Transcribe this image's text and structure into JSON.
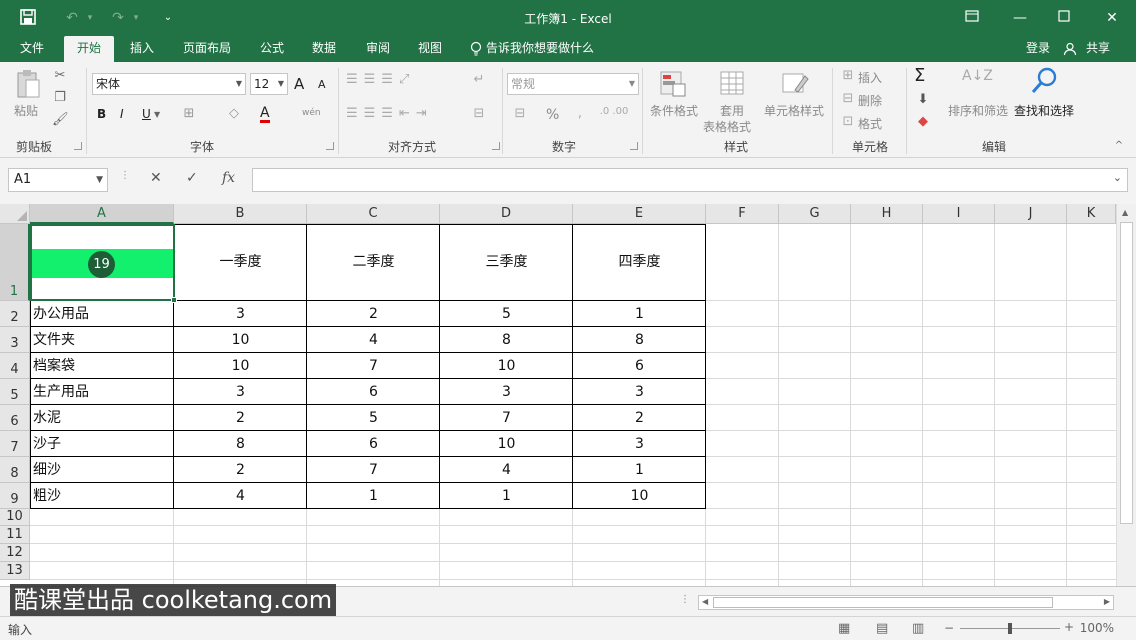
{
  "window": {
    "title": "工作簿1 - Excel",
    "sign_in": "登录",
    "share": "共享"
  },
  "tabs": [
    "文件",
    "开始",
    "插入",
    "页面布局",
    "公式",
    "数据",
    "审阅",
    "视图"
  ],
  "tell_me": "告诉我你想要做什么",
  "ribbon": {
    "paste": "粘贴",
    "clipboard": "剪贴板",
    "font_name": "宋体",
    "font_size": "12",
    "font_group": "字体",
    "align_group": "对齐方式",
    "number_format": "常规",
    "number_group": "数字",
    "conditional_format": "条件格式",
    "table_format_1": "套用",
    "table_format_2": "表格格式",
    "cell_style": "单元格样式",
    "style_group": "样式",
    "insert": "插入",
    "delete": "删除",
    "format": "格式",
    "cells_group": "单元格",
    "sort_filter": "排序和筛选",
    "find_select": "查找和选择",
    "edit_group": "编辑",
    "bold": "B",
    "italic": "I",
    "underline": "U",
    "grow_font": "A",
    "shrink_font": "A",
    "font_color": "A",
    "phonetic": "wén",
    "percent": "%"
  },
  "formula_bar": {
    "name_box": "A1",
    "fx": "fx",
    "content": ""
  },
  "grid": {
    "columns": [
      "A",
      "B",
      "C",
      "D",
      "E",
      "F",
      "G",
      "H",
      "I",
      "J",
      "K"
    ],
    "rows": [
      "1",
      "2",
      "3",
      "4",
      "5",
      "6",
      "7",
      "8",
      "9",
      "10",
      "11",
      "12",
      "13"
    ],
    "header_row": [
      "",
      "一季度",
      "二季度",
      "三季度",
      "四季度"
    ],
    "data": [
      [
        "办公用品",
        "3",
        "2",
        "5",
        "1"
      ],
      [
        "文件夹",
        "10",
        "4",
        "8",
        "8"
      ],
      [
        "档案袋",
        "10",
        "7",
        "10",
        "6"
      ],
      [
        "生产用品",
        "3",
        "6",
        "3",
        "3"
      ],
      [
        "水泥",
        "2",
        "5",
        "7",
        "2"
      ],
      [
        "沙子",
        "8",
        "6",
        "10",
        "3"
      ],
      [
        "细沙",
        "2",
        "7",
        "4",
        "1"
      ],
      [
        "粗沙",
        "4",
        "1",
        "1",
        "10"
      ]
    ],
    "row_height_badge": "19"
  },
  "status": {
    "mode": "输入",
    "zoom": "100%"
  },
  "watermark": "酷课堂出品 coolketang.com",
  "colors": {
    "excel_green": "#217346",
    "highlight": "#13f06e"
  }
}
